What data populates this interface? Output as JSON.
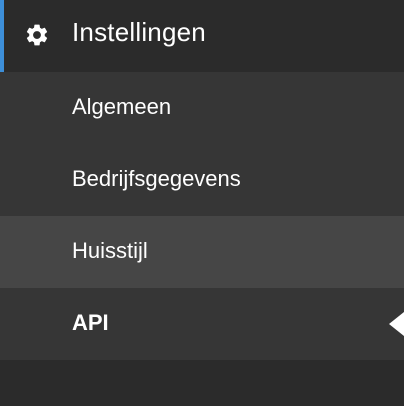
{
  "sidebar": {
    "section": {
      "label": "Instellingen",
      "icon": "gear-icon",
      "accent_color": "#3d8fd9"
    },
    "items": [
      {
        "label": "Algemeen",
        "state": "default"
      },
      {
        "label": "Bedrijfsgegevens",
        "state": "default"
      },
      {
        "label": "Huisstijl",
        "state": "hover"
      },
      {
        "label": "API",
        "state": "active"
      }
    ]
  }
}
